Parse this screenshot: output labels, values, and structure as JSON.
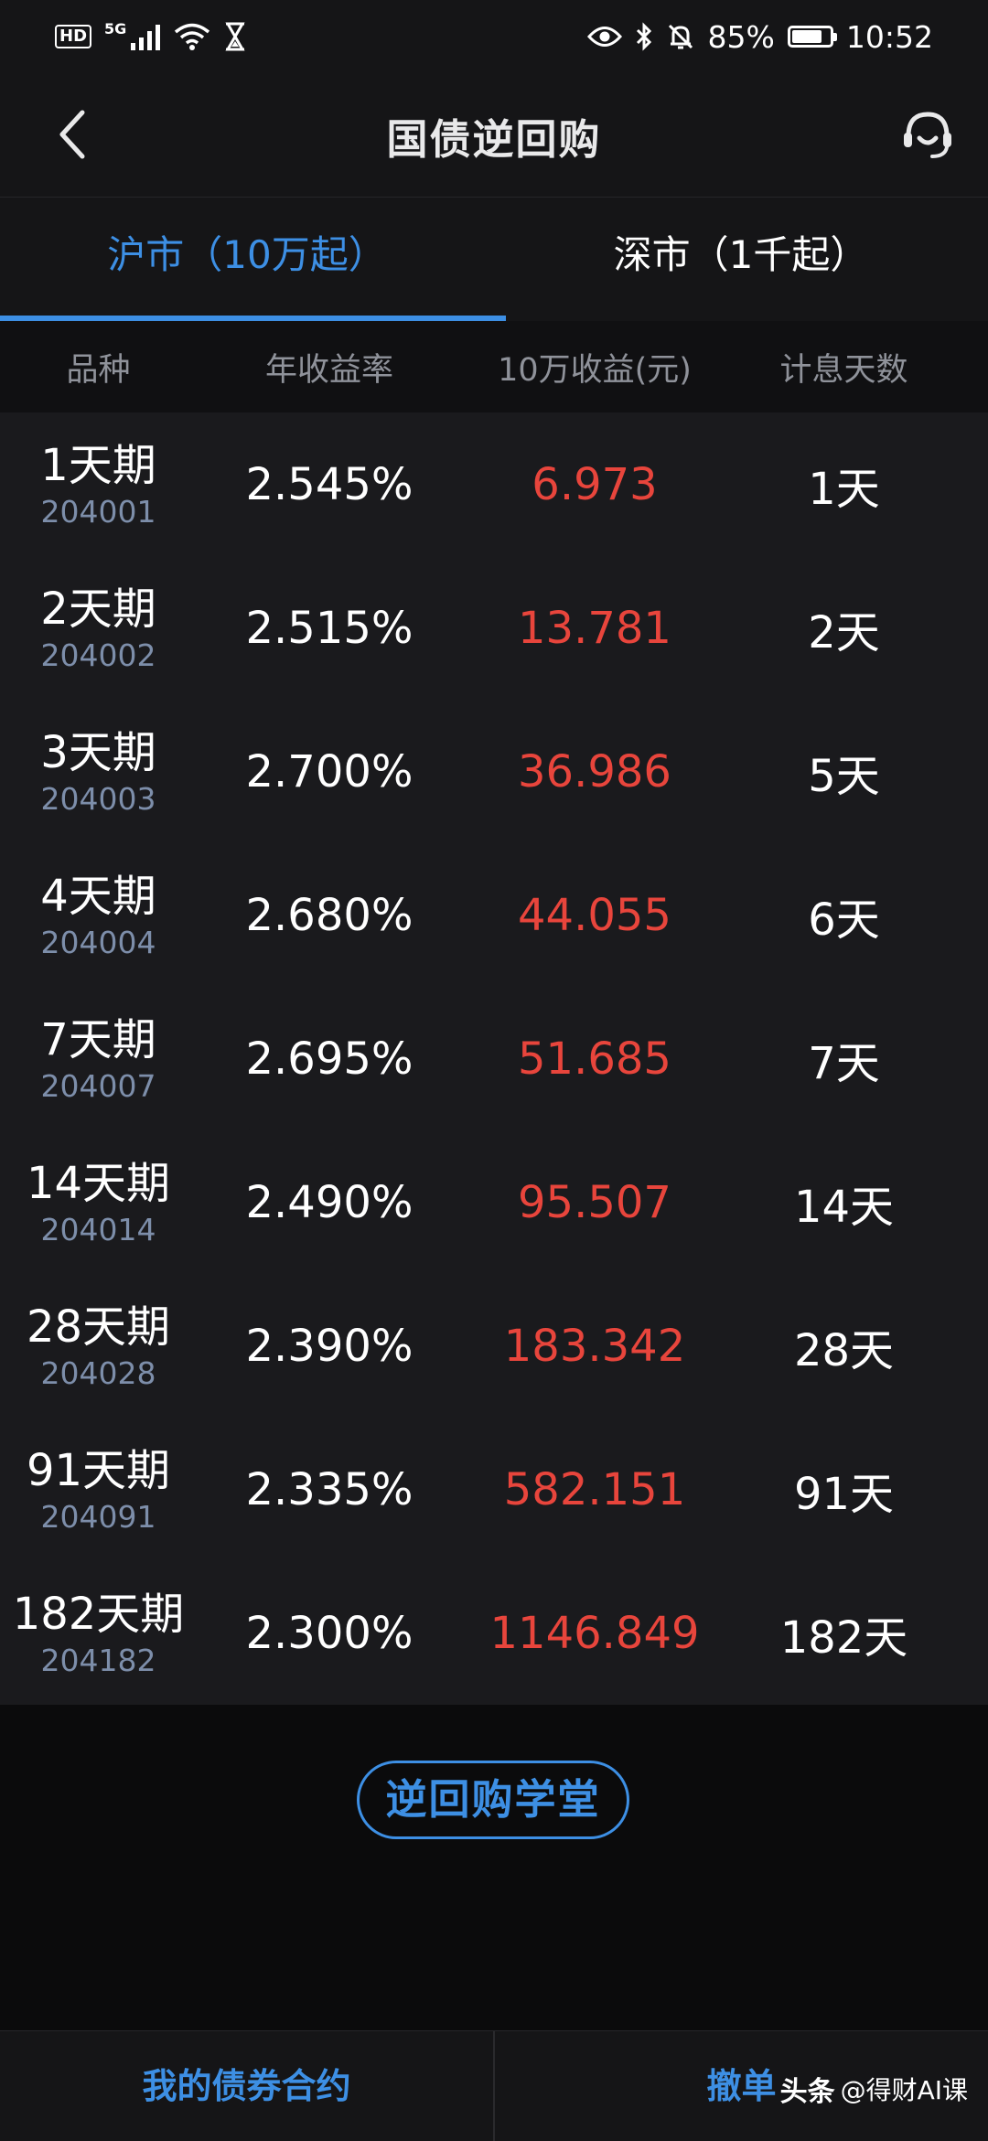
{
  "status_bar": {
    "hd": "HD",
    "network": "5G",
    "battery_percent": "85%",
    "battery_level": 0.85,
    "time": "10:52"
  },
  "header": {
    "title": "国债逆回购",
    "back_icon": "chevron-left-icon",
    "service_icon": "headset-icon"
  },
  "tabs": [
    {
      "label": "沪市（10万起）",
      "active": true
    },
    {
      "label": "深市（1千起）",
      "active": false
    }
  ],
  "table": {
    "columns": [
      "品种",
      "年收益率",
      "10万收益(元)",
      "计息天数"
    ],
    "rows": [
      {
        "name": "1天期",
        "code": "204001",
        "rate": "2.545%",
        "income": "6.973",
        "days": "1天"
      },
      {
        "name": "2天期",
        "code": "204002",
        "rate": "2.515%",
        "income": "13.781",
        "days": "2天"
      },
      {
        "name": "3天期",
        "code": "204003",
        "rate": "2.700%",
        "income": "36.986",
        "days": "5天"
      },
      {
        "name": "4天期",
        "code": "204004",
        "rate": "2.680%",
        "income": "44.055",
        "days": "6天"
      },
      {
        "name": "7天期",
        "code": "204007",
        "rate": "2.695%",
        "income": "51.685",
        "days": "7天"
      },
      {
        "name": "14天期",
        "code": "204014",
        "rate": "2.490%",
        "income": "95.507",
        "days": "14天"
      },
      {
        "name": "28天期",
        "code": "204028",
        "rate": "2.390%",
        "income": "183.342",
        "days": "28天"
      },
      {
        "name": "91天期",
        "code": "204091",
        "rate": "2.335%",
        "income": "582.151",
        "days": "91天"
      },
      {
        "name": "182天期",
        "code": "204182",
        "rate": "2.300%",
        "income": "1146.849",
        "days": "182天"
      }
    ]
  },
  "school_button": "逆回购学堂",
  "bottom_bar": {
    "left": "我的债券合约",
    "right": "撤单"
  },
  "watermark": {
    "logo": "头条",
    "handle": "@得财AI课"
  },
  "colors": {
    "accent": "#3d8fe4",
    "income_red": "#e8453c",
    "code_gray_blue": "#7d8eaa"
  }
}
